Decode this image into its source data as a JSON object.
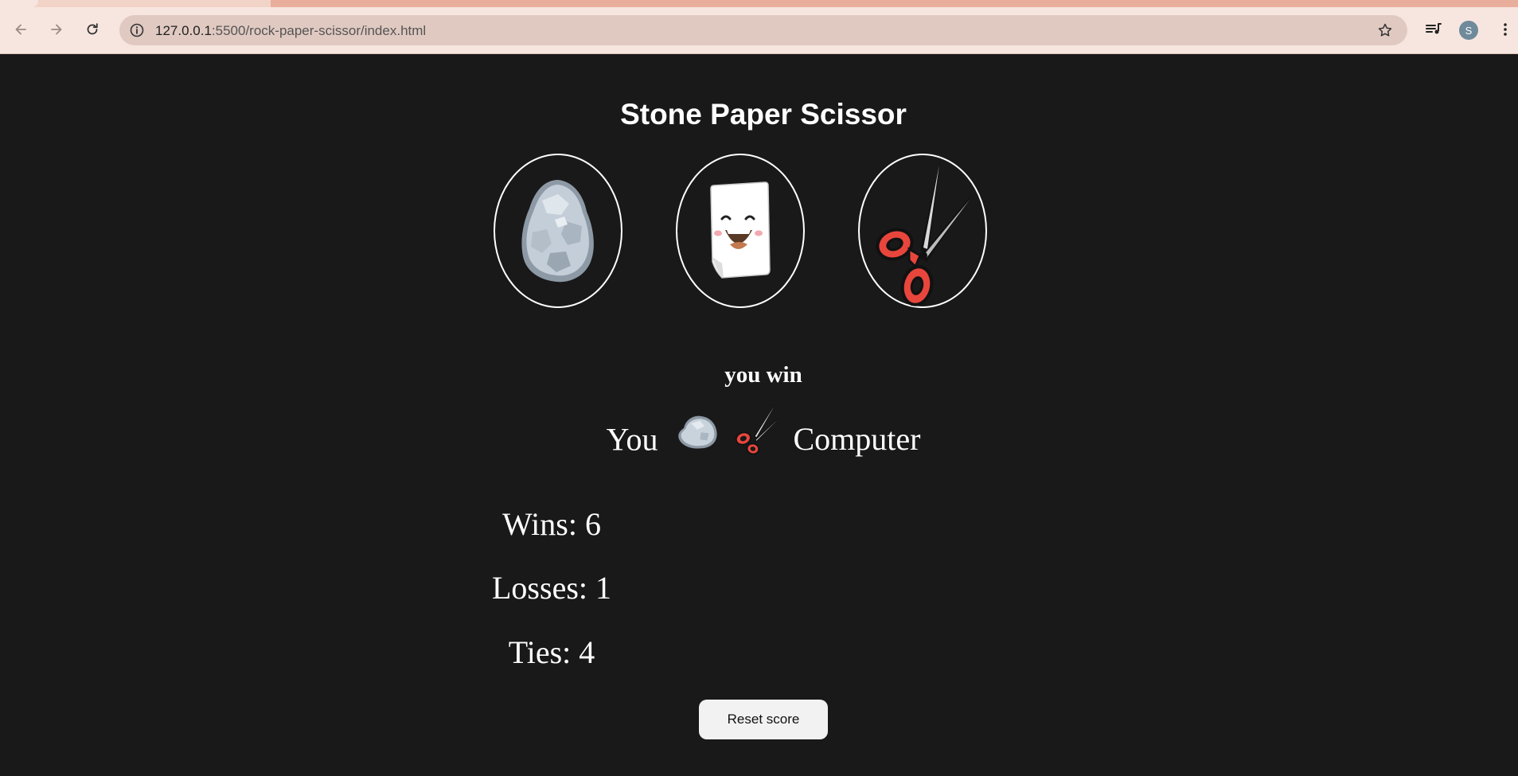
{
  "browser": {
    "url_host": "127.0.0.1",
    "url_rest": ":5500/rock-paper-scissor/index.html",
    "profile_initial": "S"
  },
  "game": {
    "title": "Stone Paper Scissor",
    "moves": [
      {
        "name": "stone",
        "icon": "stone-icon"
      },
      {
        "name": "paper",
        "icon": "paper-icon"
      },
      {
        "name": "scissor",
        "icon": "scissor-icon"
      }
    ],
    "result": "you win",
    "you_label": "You",
    "computer_label": "Computer",
    "player_move_icon": "stone-icon",
    "computer_move_icon": "scissor-icon",
    "score": {
      "wins_text": "Wins: 6",
      "losses_text": "Losses: 1",
      "ties_text": "Ties: 4"
    },
    "reset_label": "Reset score"
  },
  "colors": {
    "page_bg": "#191919",
    "chrome_bg": "#f7e6df",
    "omnibox_bg": "#e0c9c1",
    "scissor_handle": "#e8463c"
  }
}
